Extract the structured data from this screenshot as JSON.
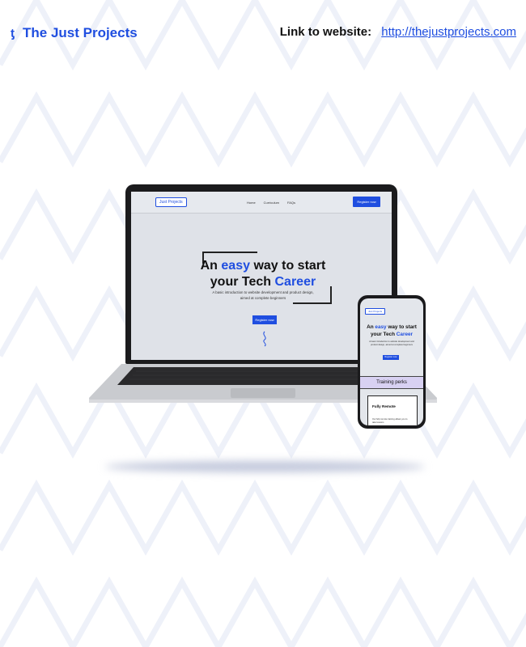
{
  "header": {
    "brand_name": "The Just Projects",
    "link_label": "Link to website:",
    "link_url": "http://thejustprojects.com"
  },
  "laptop": {
    "nav_logo": "Just Projects",
    "nav_links": [
      "Home",
      "Curriculum",
      "FAQs"
    ],
    "nav_button": "Register now",
    "hero_pre": "An ",
    "hero_easy": "easy",
    "hero_mid": " way to start",
    "hero_line2": "your Tech ",
    "hero_career": "Career",
    "hero_sub": "A basic introduction to website development and product design, aimed at complete beginners",
    "hero_button": "Register now"
  },
  "phone": {
    "nav_logo": "Just Projects",
    "hero_pre": "An ",
    "hero_easy": "easy",
    "hero_mid": " way to start",
    "hero_line2": "your Tech ",
    "hero_career": "Career",
    "hero_sub": "A basic introduction to website development and product design, aimed at complete beginners",
    "hero_button": "Register now",
    "band_label": "Training perks",
    "card_title": "Fully Remote",
    "card_text": "Our fully remote training allows you to take lessons"
  },
  "colors": {
    "accent": "#1f4ee0",
    "band": "#d8d1f2"
  }
}
